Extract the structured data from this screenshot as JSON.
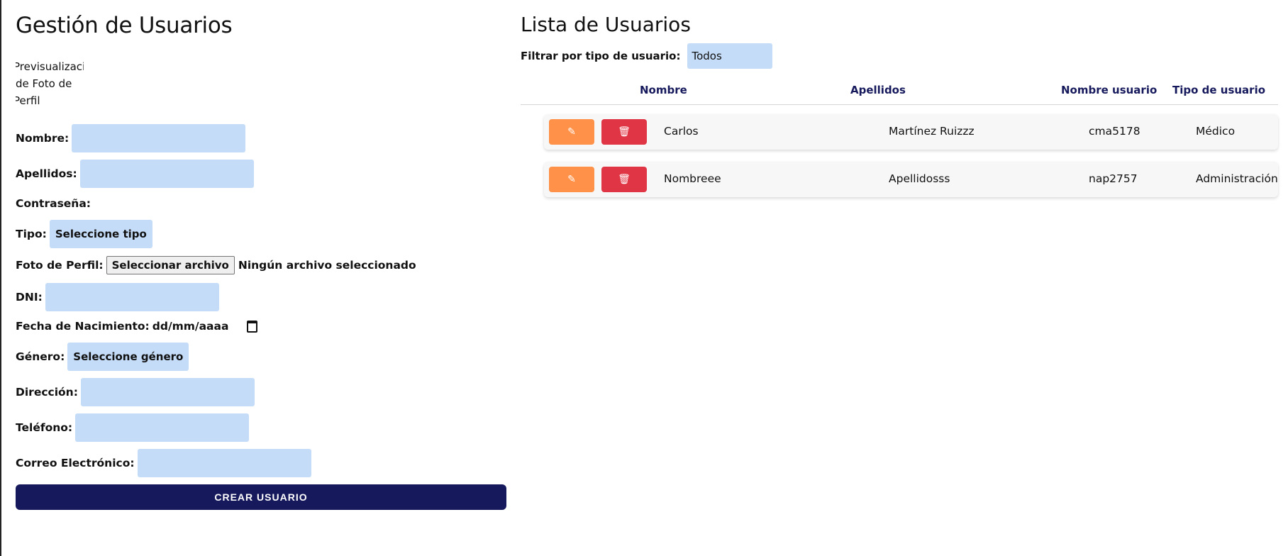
{
  "form": {
    "title": "Gestión de Usuarios",
    "preview_lines": [
      "Previsualizaci",
      "de Foto de",
      "Perfil"
    ],
    "labels": {
      "nombre": "Nombre:",
      "apellidos": "Apellidos:",
      "contrasena": "Contraseña:",
      "tipo": "Tipo:",
      "foto": "Foto de Perfil:",
      "dni": "DNI:",
      "fecha": "Fecha de Nacimiento:",
      "genero": "Género:",
      "direccion": "Dirección:",
      "telefono": "Teléfono:",
      "correo": "Correo Electrónico:"
    },
    "tipo_selected": "Seleccione tipo",
    "file_button": "Seleccionar archivo",
    "file_status": "Ningún archivo seleccionado",
    "fecha_placeholder": "dd/mm/aaaa",
    "genero_selected": "Seleccione género",
    "submit": "CREAR USUARIO"
  },
  "list": {
    "title": "Lista de Usuarios",
    "filter_label": "Filtrar por tipo de usuario:",
    "filter_selected": "Todos",
    "columns": [
      "Nombre",
      "Apellidos",
      "Nombre usuario",
      "Tipo de usuario"
    ],
    "rows": [
      {
        "nombre": "Carlos",
        "apellidos": "Martínez Ruizzz",
        "usuario": "cma5178",
        "tipo": "Médico"
      },
      {
        "nombre": "Nombreee",
        "apellidos": "Apellidosss",
        "usuario": "nap2757",
        "tipo": "Administración"
      }
    ]
  },
  "colors": {
    "input_bg": "#c4dcf8",
    "primary": "#16195c",
    "edit": "#ff9148",
    "delete": "#e03544"
  },
  "icons": {
    "edit": "edit-icon",
    "delete": "trash-icon",
    "date": "calendar-icon"
  }
}
